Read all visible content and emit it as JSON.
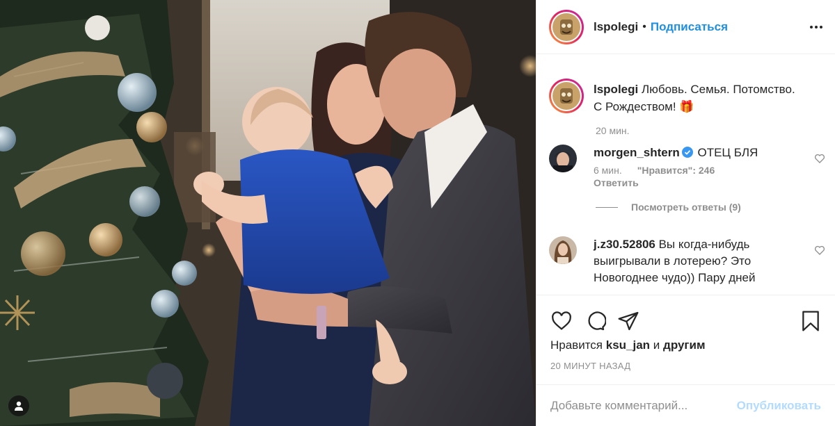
{
  "post": {
    "author": "lspolegi",
    "separator": "•",
    "follow_label": "Подписаться",
    "more_icon": "more-options-icon",
    "photo_alt": "Family portrait by a Christmas tree"
  },
  "caption": {
    "username": "lspolegi",
    "line1": "Любовь. Семья. Потомство.",
    "line2": "С Рождеством!",
    "emoji": "🎁",
    "time": "20 мин."
  },
  "comments": [
    {
      "username": "morgen_shtern",
      "verified": true,
      "text": "ОТЕЦ БЛЯ",
      "time": "6 мин.",
      "likes": "\"Нравится\": 246",
      "reply_label": "Ответить",
      "view_replies": "Посмотреть ответы (9)"
    },
    {
      "username": "j.z30.52806",
      "text": "Вы когда-нибудь выигрывали в лотерею? Это Новогоднее чудо)) Пару дней"
    }
  ],
  "likes_summary": {
    "prefix": "Нравится",
    "user": "ksu_jan",
    "conj": "и",
    "others": "другим"
  },
  "timestamp": "20 МИНУТ НАЗАД",
  "add_comment": {
    "placeholder": "Добавьте комментарий...",
    "publish_label": "Опубликовать"
  },
  "colors": {
    "accent": "#1e8fe0",
    "publish_disabled": "#b3dbff",
    "muted": "#8e8e8e",
    "text": "#262626",
    "verified": "#3897f0"
  }
}
